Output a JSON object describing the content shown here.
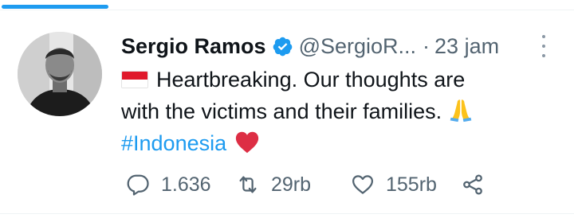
{
  "tweet": {
    "author_name": "Sergio Ramos",
    "author_handle": "@SergioR...",
    "separator": "·",
    "timestamp": "23 jam",
    "text_line_1": "Heartbreaking. Our thoughts are",
    "text_line_2": "with the victims and their families.",
    "hashtag": "#Indonesia",
    "emojis": [
      "indonesia-flag",
      "folded-hands",
      "red-heart"
    ]
  },
  "actions": {
    "reply_count": "1.636",
    "retweet_count": "29rb",
    "like_count": "155rb"
  },
  "colors": {
    "accent": "#1d9bf0",
    "text": "#0f1419",
    "secondary_text": "#536471",
    "heart": "#dd2e44"
  }
}
